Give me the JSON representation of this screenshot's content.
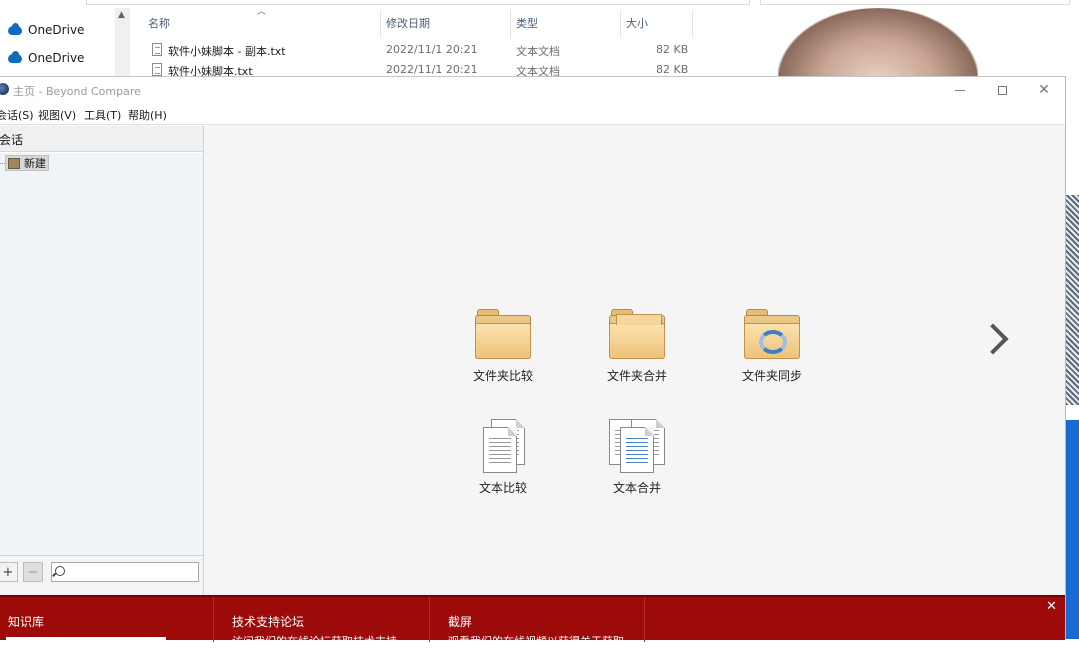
{
  "explorer": {
    "nav": [
      "OneDrive",
      "OneDrive"
    ],
    "columns": {
      "name": "名称",
      "date": "修改日期",
      "type": "类型",
      "size": "大小"
    },
    "files": [
      {
        "name": "软件小妹脚本 - 副本.txt",
        "date": "2022/11/1 20:21",
        "type": "文本文档",
        "size": "82 KB"
      },
      {
        "name": "软件小妹脚本.txt",
        "date": "2022/11/1 20:21",
        "type": "文本文档",
        "size": "82 KB"
      }
    ]
  },
  "window": {
    "title": "主页 - Beyond Compare",
    "menu": [
      "会话(S)",
      "视图(V)",
      "工具(T)",
      "帮助(H)"
    ]
  },
  "sidebar": {
    "header": "会话",
    "tree": [
      "新建"
    ],
    "add": "+",
    "remove": "−",
    "search_value": ""
  },
  "launchers": [
    {
      "label": "文件夹比较",
      "icon": "folder-compare-icon"
    },
    {
      "label": "文件夹合并",
      "icon": "folder-merge-icon"
    },
    {
      "label": "文件夹同步",
      "icon": "folder-sync-icon"
    },
    {
      "label": "文本比较",
      "icon": "text-compare-icon"
    },
    {
      "label": "文本合并",
      "icon": "text-merge-icon"
    }
  ],
  "bottom": {
    "sections": [
      {
        "title": "知识库",
        "desc": ""
      },
      {
        "title": "技术支持论坛",
        "desc": "访问我们的在线论坛获取技术支持"
      },
      {
        "title": "截屏",
        "desc": "观看我们的在线视频以获得关于获取"
      }
    ],
    "close": "✕"
  },
  "colors": {
    "banner": "#9d0a0a",
    "accent_blue": "#0f6cbd"
  }
}
